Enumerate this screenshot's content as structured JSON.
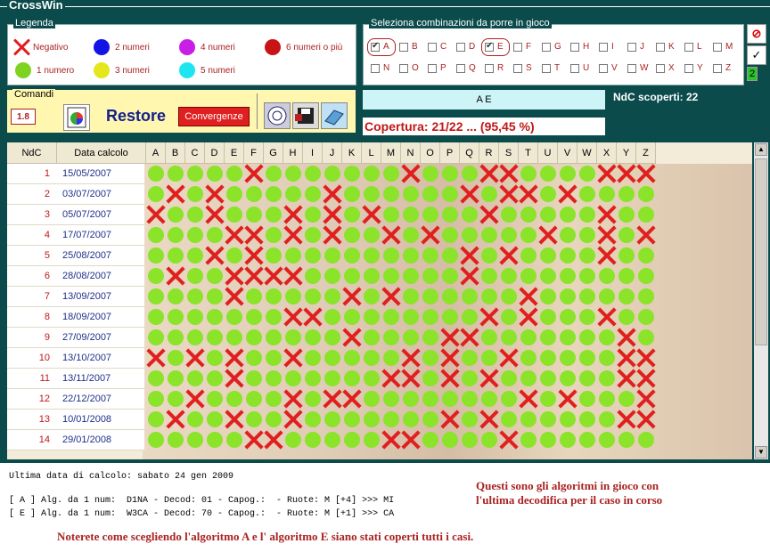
{
  "window": {
    "title": "CrossWin"
  },
  "legend": {
    "title": "Legenda",
    "items": [
      {
        "label": "Negativo",
        "kind": "x"
      },
      {
        "label": "1 numero",
        "color": "#7ed321"
      },
      {
        "label": "2 numeri",
        "color": "#1414e6"
      },
      {
        "label": "3 numeri",
        "color": "#e6e61e"
      },
      {
        "label": "4 numeri",
        "color": "#c81ee6"
      },
      {
        "label": "5 numeri",
        "color": "#1ee6f0"
      },
      {
        "label": "6 numeri o più",
        "color": "#c81414"
      }
    ]
  },
  "selection": {
    "title": "Seleziona combinazioni da porre in gioco",
    "letters": [
      "A",
      "B",
      "C",
      "D",
      "E",
      "F",
      "G",
      "H",
      "I",
      "J",
      "K",
      "L",
      "M",
      "N",
      "O",
      "P",
      "Q",
      "R",
      "S",
      "T",
      "U",
      "V",
      "W",
      "X",
      "Y",
      "Z"
    ],
    "checked": [
      "A",
      "E"
    ]
  },
  "side_buttons": [
    "no-icon",
    "check-icon",
    "2"
  ],
  "commands": {
    "title": "Comandi",
    "value": "1.8",
    "restore_label": "Restore",
    "convergence_label": "Convergenze"
  },
  "selected_combo": "A E",
  "ndc_found": "NdC scoperti: 22",
  "coverage": "Copertura: 21/22 ... (95,45 %)",
  "table": {
    "col_ndc": "NdC",
    "col_date": "Data calcolo",
    "letters": [
      "A",
      "B",
      "C",
      "D",
      "E",
      "F",
      "G",
      "H",
      "I",
      "J",
      "K",
      "L",
      "M",
      "N",
      "O",
      "P",
      "Q",
      "R",
      "S",
      "T",
      "U",
      "V",
      "W",
      "X",
      "Y",
      "Z"
    ],
    "rows": [
      {
        "ndc": "1",
        "date": "15/05/2007",
        "marks": "oooooxoooooooxoooxxooooxxxoo"
      },
      {
        "ndc": "2",
        "date": "03/07/2007",
        "marks": "oxoxoooooxooooooxoxxoxoooox"
      },
      {
        "ndc": "3",
        "date": "05/07/2007",
        "marks": "xooxoooxoxoxoooooxoooooxoox"
      },
      {
        "ndc": "4",
        "date": "17/07/2007",
        "marks": "ooooxxoxoxooxoxoooooxooxoxx"
      },
      {
        "ndc": "5",
        "date": "25/08/2007",
        "marks": "oooxoxooooooooooxoxooooxoooo"
      },
      {
        "ndc": "6",
        "date": "28/08/2007",
        "marks": "oxooxxxxooooooooxoooooooooxx"
      },
      {
        "ndc": "7",
        "date": "13/09/2007",
        "marks": "ooooxoooooxoxooooooxoooooooox"
      },
      {
        "ndc": "8",
        "date": "18/09/2007",
        "marks": "oooooooxxooooooooxoxoooxoooo"
      },
      {
        "ndc": "9",
        "date": "27/09/2007",
        "marks": "ooooooooooxooooxxoooooooxooooo"
      },
      {
        "ndc": "10",
        "date": "13/10/2007",
        "marks": "xoxoxooxoooooxoxooxoooooxxoxx"
      },
      {
        "ndc": "11",
        "date": "13/11/2007",
        "marks": "ooooxoooooooxxoxoxooooooxxxoo"
      },
      {
        "ndc": "12",
        "date": "22/12/2007",
        "marks": "ooxooooxoxxooooooooxoxoooxxx"
      },
      {
        "ndc": "13",
        "date": "10/01/2008",
        "marks": "oxooxooxoooooooxoxooooooxxoox"
      },
      {
        "ndc": "14",
        "date": "29/01/2008",
        "marks": "oooooxxoooooxxooooxoooooooooxo"
      }
    ]
  },
  "bottom": {
    "last_calc": "Ultima data di calcolo: sabato 24 gen 2009",
    "line_a": "[ A ] Alg. da 1 num:  D1NA - Decod: 01 - Capog.:  - Ruote: M [+4] >>> MI",
    "line_e": "[ E ] Alg. da 1 num:  W3CA - Decod: 70 - Capog.:  - Ruote: M [+1] >>> CA",
    "note_1": "Questi sono gli algoritmi in gioco con",
    "note_2": "l'ultima decodifica per il caso in corso",
    "note_3": "Noterete come scegliendo l'algoritmo A e l' algoritmo E siano stati coperti tutti i casi."
  }
}
